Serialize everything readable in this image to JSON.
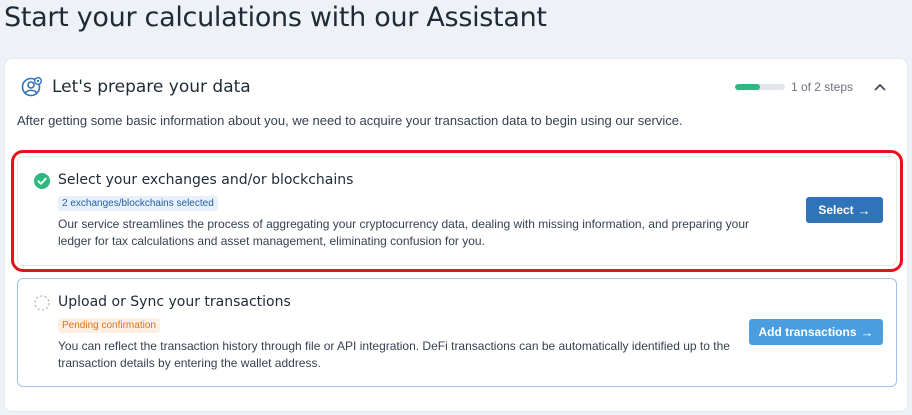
{
  "page": {
    "title": "Start your calculations with our Assistant"
  },
  "card": {
    "title": "Let's prepare your data",
    "progress": {
      "fraction": 0.5,
      "label": "1 of 2 steps"
    },
    "intro": "After getting some basic information about you, we need to acquire your transaction data to begin using our service.",
    "icons": {
      "header": "user-settings-icon",
      "collapse": "chevron-up-icon"
    }
  },
  "steps": [
    {
      "title": "Select your exchanges and/or blockchains",
      "badge": "2 exchanges/blockchains selected",
      "description": "Our service streamlines the process of aggregating your cryptocurrency data, dealing with missing information, and preparing your ledger for tax calculations and asset management, eliminating confusion for you.",
      "button": "Select",
      "status": "completed",
      "icon": "check-circle-icon"
    },
    {
      "title": "Upload or Sync your transactions",
      "badge": "Pending confirmation",
      "description": "You can reflect the transaction history through file or API integration. DeFi transactions can be automatically identified up to the transaction details by entering the wallet address.",
      "button": "Add transactions",
      "status": "pending",
      "icon": "pending-circle-icon"
    }
  ],
  "colors": {
    "accent": "#2f73b8",
    "success": "#2fb981",
    "highlight": "#e5111b",
    "pending": "#d9731d"
  }
}
